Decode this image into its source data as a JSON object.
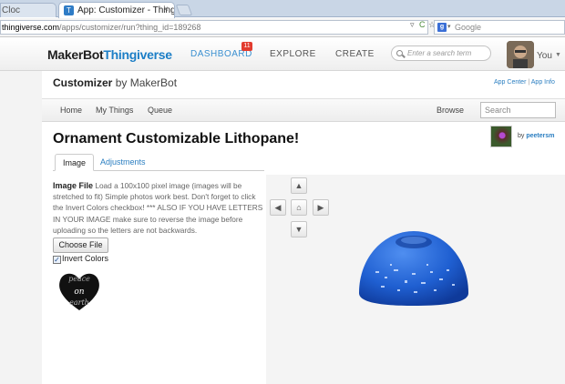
{
  "browser": {
    "prev_tab_label": "Cloc",
    "active_tab_title": "App: Customizer - Thingiver",
    "url_host": "thingiverse.com",
    "url_path": "/apps/customizer/run?thing_id=189268",
    "search_engine_placeholder": "Google",
    "tab_close_glyph": "×",
    "url_reload_glyph": "C",
    "url_caret_glyph": "▿",
    "url_star_glyph": "☆"
  },
  "site": {
    "logo_part1": "MakerBot",
    "logo_part2": "Thingiverse",
    "nav": {
      "dashboard": "DASHBOARD",
      "dashboard_badge": "11",
      "explore": "EXPLORE",
      "create": "CREATE"
    },
    "search_placeholder": "Enter a search term",
    "user_label": "You"
  },
  "customizer": {
    "title": "Customizer",
    "by": "by MakerBot",
    "app_center": "App Center",
    "app_info": "App Info",
    "subnav": {
      "home": "Home",
      "my_things": "My Things",
      "queue": "Queue",
      "browse": "Browse",
      "search_placeholder": "Search"
    }
  },
  "thing": {
    "title": "Ornament Customizable Lithopane!",
    "creator_by": "by",
    "creator_name": "peetersm"
  },
  "tabs": {
    "image": "Image",
    "adjustments": "Adjustments"
  },
  "param": {
    "label": "Image File",
    "description": "Load a 100x100 pixel image (images will be stretched to fit) Simple photos work best. Don't forget to click the Invert Colors checkbox! *** ALSO IF YOU HAVE LETTERS IN YOUR IMAGE make sure to reverse the image before uploading so the letters are not backwards.",
    "choose_file": "Choose File",
    "invert_colors": "Invert Colors",
    "invert_checked": true,
    "preview_text_top": "peace",
    "preview_text_mid": "on",
    "preview_text_bottom": "earth"
  },
  "viewer": {
    "up": "▲",
    "down": "▼",
    "left": "◀",
    "right": "▶",
    "home": "⌂",
    "dome_color": "#1f5fd1"
  }
}
